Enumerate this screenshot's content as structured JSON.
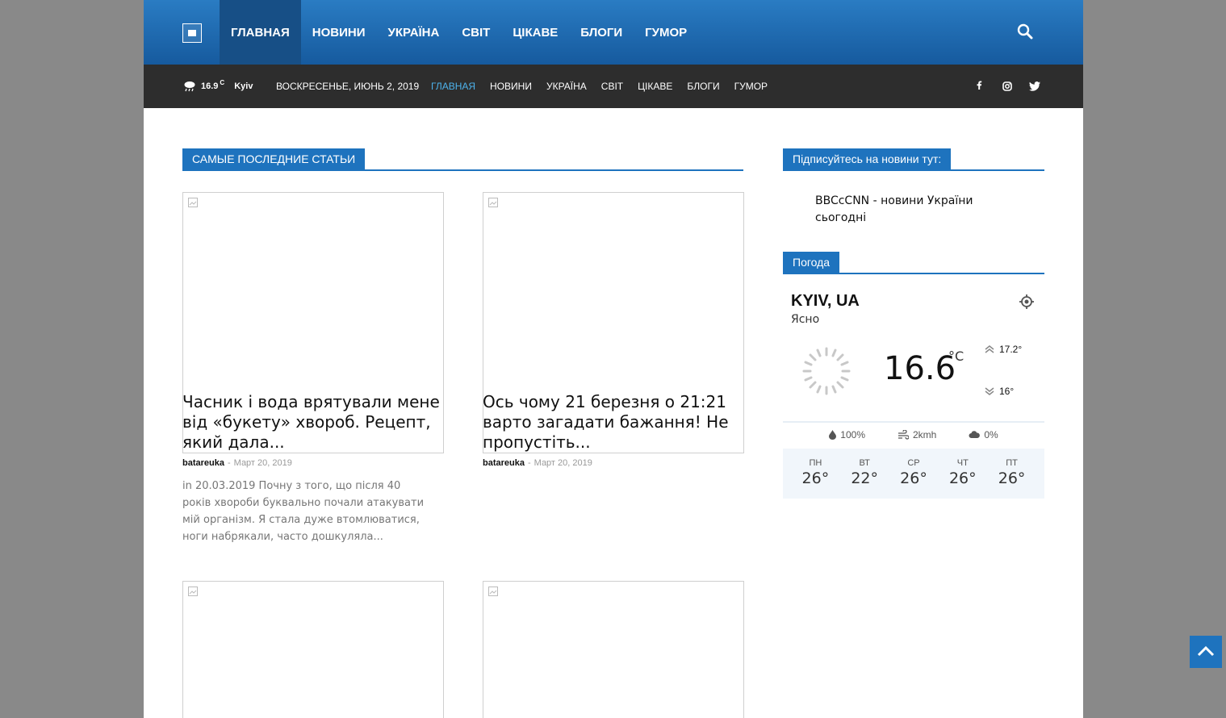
{
  "header": {
    "nav": [
      {
        "label": "ГЛАВНАЯ",
        "active": true
      },
      {
        "label": "НОВИНИ",
        "active": false
      },
      {
        "label": "УКРАЇНА",
        "active": false
      },
      {
        "label": "СВІТ",
        "active": false
      },
      {
        "label": "ЦІКАВЕ",
        "active": false
      },
      {
        "label": "БЛОГИ",
        "active": false
      },
      {
        "label": "ГУМОР",
        "active": false
      }
    ]
  },
  "subheader": {
    "weather_temp": "16.9",
    "weather_unit": "C",
    "weather_city": "Kyiv",
    "date": "ВОСКРЕСЕНЬЕ, ИЮНЬ 2, 2019",
    "nav": [
      {
        "label": "ГЛАВНАЯ",
        "active": true
      },
      {
        "label": "НОВИНИ",
        "active": false
      },
      {
        "label": "УКРАЇНА",
        "active": false
      },
      {
        "label": "СВІТ",
        "active": false
      },
      {
        "label": "ЦІКАВЕ",
        "active": false
      },
      {
        "label": "БЛОГИ",
        "active": false
      },
      {
        "label": "ГУМОР",
        "active": false
      }
    ],
    "socials": [
      "facebook-icon",
      "instagram-icon",
      "twitter-icon"
    ]
  },
  "main": {
    "block_title": "САМЫЕ ПОСЛЕДНИЕ СТАТЬИ",
    "articles": [
      {
        "title": "Часник і вода врятували мене від «букету» хвороб. Рецепт, який дала...",
        "author": "batareuka",
        "sep": "-",
        "date": "Март 20, 2019",
        "excerpt": "in 20.03.2019 Почну з того, що після 40 років хвороби буквально почали атакувати мій організм. Я стала дуже втомлюватися, ноги набрякали, часто дошкуляла..."
      },
      {
        "title": "Ось чому 21 березня о 21:21 варто загадати бажання! Не пропустіть...",
        "author": "batareuka",
        "sep": "-",
        "date": "Март 20, 2019",
        "excerpt": ""
      }
    ]
  },
  "sidebar": {
    "subscribe_title": "Підписуйтесь на новини тут:",
    "subscribe_link": "BBCcCNN - новини України сьогодні",
    "weather_title": "Погода",
    "weather": {
      "city": "KYIV, UA",
      "desc": "Ясно",
      "temp": "16.6",
      "unit": "°C",
      "high": "17.2°",
      "low": "16°",
      "humidity": "100%",
      "wind": "2kmh",
      "clouds": "0%",
      "forecast": [
        {
          "day": "ПН",
          "temp": "26°"
        },
        {
          "day": "ВТ",
          "temp": "22°"
        },
        {
          "day": "СР",
          "temp": "26°"
        },
        {
          "day": "ЧТ",
          "temp": "26°"
        },
        {
          "day": "ПТ",
          "temp": "26°"
        }
      ]
    }
  },
  "colors": {
    "accent": "#1e73be",
    "header_top": "#2a7cc3",
    "header_bottom": "#165a9e",
    "subheader": "#2d2d2d",
    "active_subnav": "#4db2ec"
  }
}
